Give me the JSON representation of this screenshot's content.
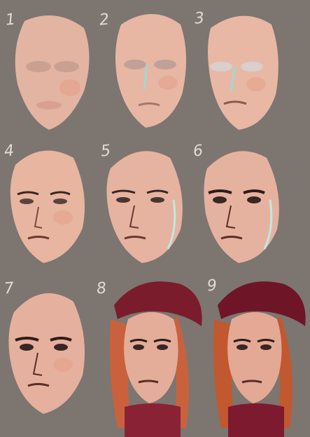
{
  "steps": [
    {
      "number": "1"
    },
    {
      "number": "2"
    },
    {
      "number": "3"
    },
    {
      "number": "4"
    },
    {
      "number": "5"
    },
    {
      "number": "6"
    },
    {
      "number": "7"
    },
    {
      "number": "8"
    },
    {
      "number": "9"
    }
  ],
  "colors": {
    "background": "#7d7570",
    "skin": "#e9b7a2",
    "skin_shadow": "#c98f7f",
    "highlight": "#bfe8e2",
    "eye_dark": "#3a2622",
    "hair": "#c9623c",
    "hat": "#7a1c2c",
    "scarf": "#8a2236"
  },
  "icons": [
    "face-sketch",
    "hair",
    "hat",
    "scarf"
  ]
}
